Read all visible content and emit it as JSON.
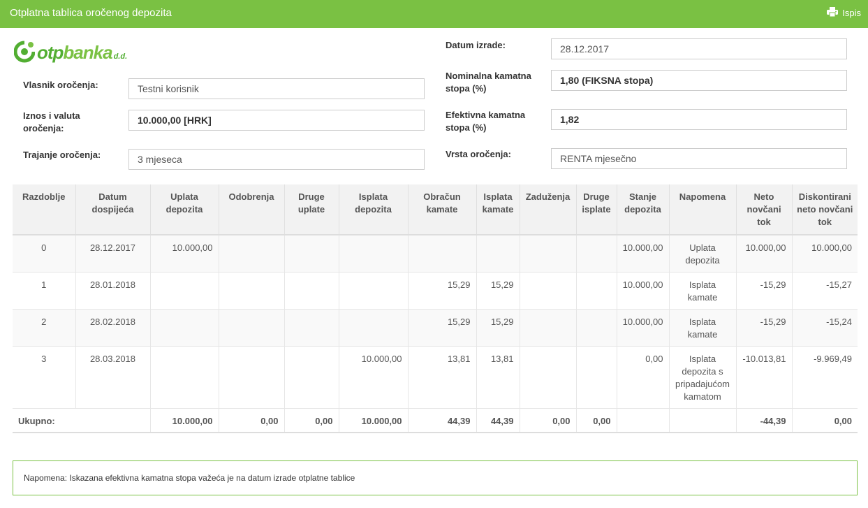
{
  "header": {
    "title": "Otplatna tablica oročenog depozita",
    "print_label": "Ispis",
    "bg_color": "#7ac143"
  },
  "logo": {
    "text_otp": "otp",
    "text_banka": "banka",
    "text_dd": "d.d."
  },
  "form": {
    "owner_label": "Vlasnik oročenja:",
    "owner_value": "Testni korisnik",
    "amount_label": "Iznos i valuta oročenja:",
    "amount_value": "10.000,00 [HRK]",
    "duration_label": "Trajanje oročenja:",
    "duration_value": "3 mjeseca",
    "created_label": "Datum izrade:",
    "created_value": "28.12.2017",
    "nominal_label": "Nominalna kamatna stopa (%)",
    "nominal_value": "1,80  (FIKSNA stopa)",
    "effective_label": "Efektivna kamatna stopa (%)",
    "effective_value": "1,82",
    "type_label": "Vrsta oročenja:",
    "type_value": "RENTA mjesečno"
  },
  "table": {
    "headers": [
      "Razdoblje",
      "Datum dospijeća",
      "Uplata depozita",
      "Odobrenja",
      "Druge uplate",
      "Isplata depozita",
      "Obračun kamate",
      "Isplata kamate",
      "Zaduženja",
      "Druge isplate",
      "Stanje depozita",
      "Napomena",
      "Neto novčani tok",
      "Diskontirani neto novčani tok"
    ],
    "rows": [
      [
        "0",
        "28.12.2017",
        "10.000,00",
        "",
        "",
        "",
        "",
        "",
        "",
        "",
        "10.000,00",
        "Uplata depozita",
        "10.000,00",
        "10.000,00"
      ],
      [
        "1",
        "28.01.2018",
        "",
        "",
        "",
        "",
        "15,29",
        "15,29",
        "",
        "",
        "10.000,00",
        "Isplata kamate",
        "-15,29",
        "-15,27"
      ],
      [
        "2",
        "28.02.2018",
        "",
        "",
        "",
        "",
        "15,29",
        "15,29",
        "",
        "",
        "10.000,00",
        "Isplata kamate",
        "-15,29",
        "-15,24"
      ],
      [
        "3",
        "28.03.2018",
        "",
        "",
        "",
        "10.000,00",
        "13,81",
        "13,81",
        "",
        "",
        "0,00",
        "Isplata depozita s pripadajućom kamatom",
        "-10.013,81",
        "-9.969,49"
      ]
    ],
    "total": {
      "label": "Ukupno:",
      "values": [
        "10.000,00",
        "0,00",
        "0,00",
        "10.000,00",
        "44,39",
        "44,39",
        "0,00",
        "0,00",
        "",
        "",
        "-44,39",
        "0,00"
      ]
    }
  },
  "note": "Napomena: Iskazana efektivna kamatna stopa važeća je na datum izrade otplatne tablice"
}
